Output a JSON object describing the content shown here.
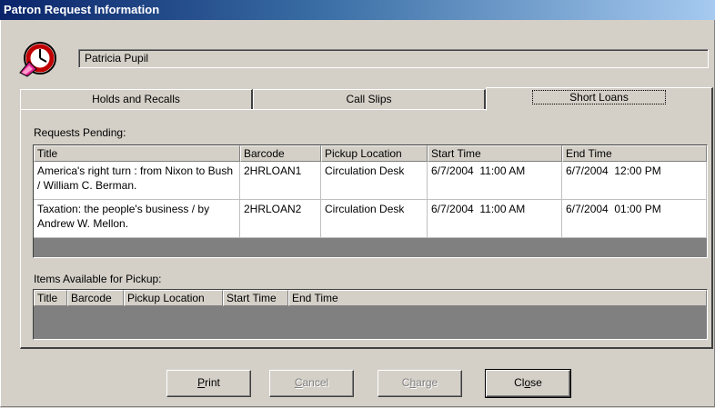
{
  "window": {
    "title": "Patron Request Information"
  },
  "patron": {
    "name": "Patricia Pupil",
    "icon": "patron-clock-icon"
  },
  "tabs": [
    {
      "label": "Holds and Recalls",
      "active": false
    },
    {
      "label": "Call Slips",
      "active": false
    },
    {
      "label": "Short Loans",
      "active": true
    }
  ],
  "requests_pending": {
    "label": "Requests Pending:",
    "columns": [
      "Title",
      "Barcode",
      "Pickup Location",
      "Start Time",
      "End Time"
    ],
    "rows": [
      {
        "title": "America's right turn : from Nixon to Bush / William C. Berman.",
        "barcode": "2HRLOAN1",
        "pickup": "Circulation Desk",
        "start": "6/7/2004  11:00 AM",
        "end": "6/7/2004  12:00 PM"
      },
      {
        "title": "Taxation: the people's business / by Andrew W. Mellon.",
        "barcode": "2HRLOAN2",
        "pickup": "Circulation Desk",
        "start": "6/7/2004  11:00 AM",
        "end": "6/7/2004  01:00 PM"
      }
    ]
  },
  "items_available": {
    "label": "Items Available for Pickup:",
    "columns": [
      "Title",
      "Barcode",
      "Pickup Location",
      "Start Time",
      "End Time"
    ]
  },
  "buttons": {
    "print": {
      "pre": "",
      "mnemonic": "P",
      "post": "rint",
      "enabled": true
    },
    "cancel": {
      "pre": "",
      "mnemonic": "C",
      "post": "ancel",
      "enabled": false
    },
    "charge": {
      "pre": "C",
      "mnemonic": "h",
      "post": "arge",
      "enabled": false
    },
    "close": {
      "pre": "Cl",
      "mnemonic": "o",
      "post": "se",
      "enabled": true
    }
  }
}
